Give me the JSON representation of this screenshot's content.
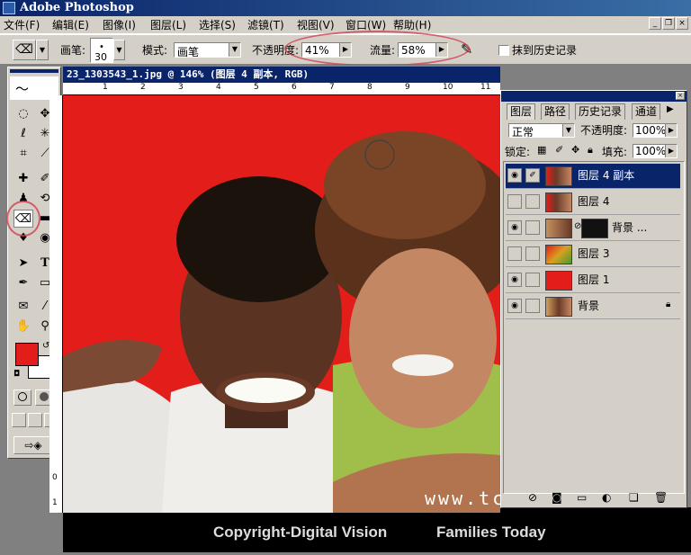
{
  "app": {
    "title": "Adobe Photoshop"
  },
  "menu": [
    "文件(F)",
    "编辑(E)",
    "图像(I)",
    "图层(L)",
    "选择(S)",
    "滤镜(T)",
    "视图(V)",
    "窗口(W)",
    "帮助(H)"
  ],
  "options": {
    "brush_label": "画笔:",
    "brush_size": "30",
    "mode_label": "模式:",
    "mode_value": "画笔",
    "opacity_label": "不透明度:",
    "opacity_value": "41%",
    "flow_label": "流量:",
    "flow_value": "58%",
    "history_label": "抹到历史记录"
  },
  "document": {
    "title": "23_1303543_1.jpg @ 146% (图层 4 副本, RGB)",
    "watermark": "www.tc",
    "copyright": "Copyright-Digital Vision",
    "series": "Families Today"
  },
  "ruler": {
    "top_labels": [
      "1",
      "2",
      "3",
      "4",
      "5",
      "6",
      "7",
      "8",
      "9",
      "10",
      "11"
    ],
    "left_labels": [
      "0",
      "1"
    ]
  },
  "layers_panel": {
    "tabs": [
      "图层",
      "路径",
      "历史记录",
      "通道"
    ],
    "blend_mode": "正常",
    "opacity_label": "不透明度:",
    "opacity_value": "100%",
    "lock_label": "锁定:",
    "fill_label": "填充:",
    "fill_value": "100%",
    "layers": [
      {
        "name": "图层 4 副本",
        "visible": true,
        "selected": true
      },
      {
        "name": "图层 4",
        "visible": false,
        "selected": false
      },
      {
        "name": "背景 ...",
        "visible": true,
        "selected": false
      },
      {
        "name": "图层 3",
        "visible": false,
        "selected": false
      },
      {
        "name": "图层 1",
        "visible": true,
        "selected": false
      },
      {
        "name": "背景",
        "visible": true,
        "selected": false
      }
    ]
  },
  "colors": {
    "foreground": "#e31e1a",
    "background": "#ffffff",
    "accent": "#0a246a"
  }
}
